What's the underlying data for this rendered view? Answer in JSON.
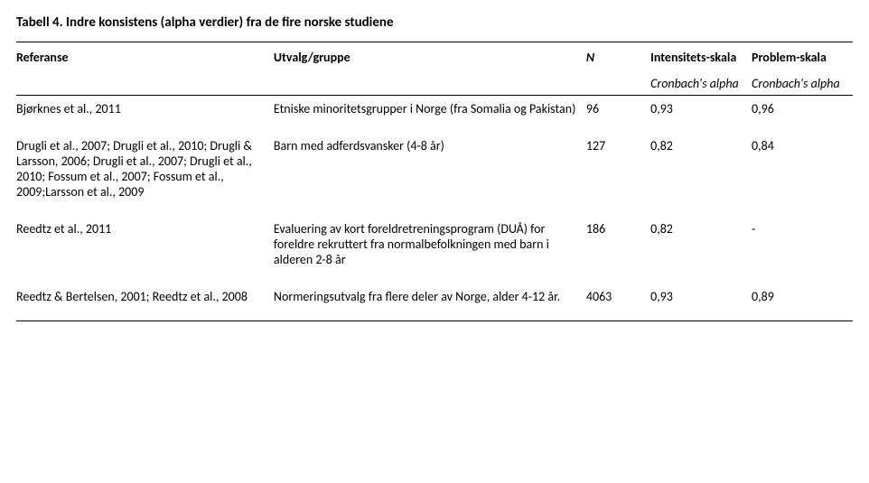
{
  "title": "Tabell 4. Indre konsistens (alpha verdier) fra de fire norske studiene",
  "headers": {
    "ref": "Referanse",
    "group": "Utvalg/gruppe",
    "n": "N",
    "intensity": "Intensitets-skala",
    "problem": "Problem-skala",
    "sub_a": "Cronbach's alpha",
    "sub_b": "Cronbach's alpha"
  },
  "rows": [
    {
      "ref": "Bjørknes et al., 2011",
      "group": "Etniske minoritetsgrupper i Norge (fra Somalia og Pakistan)",
      "n": "96",
      "a": "0,93",
      "b": "0,96"
    },
    {
      "ref": "Drugli et al., 2007; Drugli et al., 2010; Drugli & Larsson, 2006; Drugli et al., 2007; Drugli et al., 2010; Fossum et al., 2007; Fossum et al., 2009;Larsson et al., 2009",
      "group": "Barn med adferdsvansker (4-8 år)",
      "n": "127",
      "a": "0,82",
      "b": "0,84"
    },
    {
      "ref": "Reedtz et al., 2011",
      "group": "Evaluering av kort foreldretreningsprogram (DUÅ) for foreldre rekruttert fra normalbefolkningen med barn i alderen 2-8 år",
      "n": "186",
      "a": "0,82",
      "b": "-"
    },
    {
      "ref": "Reedtz & Bertelsen, 2001; Reedtz et al., 2008",
      "group": "Normeringsutvalg fra flere deler av Norge, alder 4-12 år.",
      "n": "4063",
      "a": "0,93",
      "b": "0,89"
    }
  ]
}
